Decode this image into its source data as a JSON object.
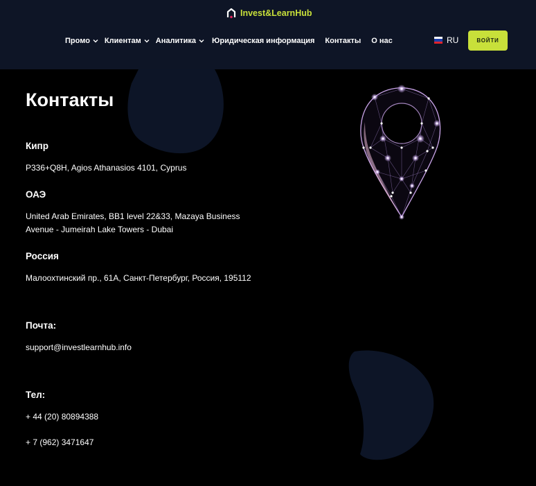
{
  "header": {
    "logo_text": "Invest&LearnHub",
    "nav": [
      {
        "label": "Промо",
        "has_dropdown": true
      },
      {
        "label": "Клиентам",
        "has_dropdown": true
      },
      {
        "label": "Аналитика",
        "has_dropdown": true
      },
      {
        "label": "Юридическая информация",
        "has_dropdown": false
      },
      {
        "label": "Контакты",
        "has_dropdown": false
      },
      {
        "label": "О нас",
        "has_dropdown": false
      }
    ],
    "language": {
      "code": "RU",
      "icon": "russian-flag-icon"
    },
    "login_label": "ВОЙТИ"
  },
  "page": {
    "title": "Контакты",
    "offices": [
      {
        "country": "Кипр",
        "address": "P336+Q8H, Agios Athanasios 4101, Cyprus"
      },
      {
        "country": "ОАЭ",
        "address_lines": [
          "United Arab Emirates, BB1 level 22&33, Mazaya Business",
          "Avenue - Jumeirah Lake Towers - Dubai"
        ]
      },
      {
        "country": "Россия",
        "address": "Малоохтинский пр., 61А, Санкт-Петербург, Россия, 195112"
      }
    ],
    "email": {
      "label": "Почта:",
      "value": "support@investlearnhub.info"
    },
    "phone": {
      "label": "Тел:",
      "values": [
        "+ 44 (20) 80894388",
        "+ 7 (962) 3471647"
      ]
    }
  },
  "colors": {
    "accent": "#c8e03a",
    "header_bg": "#0e1526",
    "page_bg": "#000000",
    "blob": "#0d1527",
    "pin_glow": "#c9a4e8"
  }
}
